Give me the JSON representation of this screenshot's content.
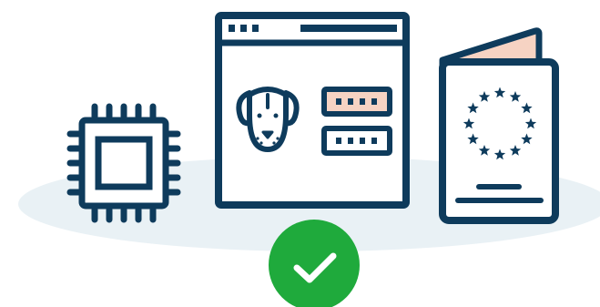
{
  "colors": {
    "background": "#ffffff",
    "ground": "#e9f1f5",
    "outline": "#0e3b5c",
    "paper": "#ffffff",
    "accent_pink": "#f6d3c3",
    "success_green": "#1faa3c",
    "check": "#ffffff"
  },
  "illustration": {
    "chip": {
      "icon": "microchip-icon"
    },
    "browser_window": {
      "icon": "browser-window-icon",
      "tab_dots": 3,
      "avatar_icon": "dog-face-icon",
      "password_fields": [
        {
          "masked_chars": 4,
          "highlighted": true
        },
        {
          "masked_chars": 4,
          "highlighted": false
        }
      ]
    },
    "passport": {
      "icon": "eu-passport-icon",
      "stars": 12
    },
    "status": {
      "icon": "checkmark-icon",
      "state": "verified"
    }
  }
}
